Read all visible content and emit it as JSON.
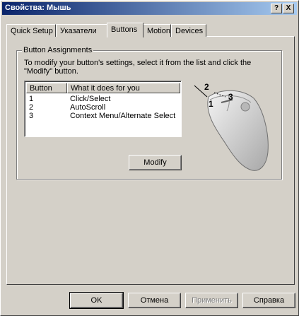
{
  "window": {
    "title": "Свойства: Мышь"
  },
  "title_buttons": {
    "help": "?",
    "close": "X"
  },
  "tabs": [
    {
      "label": "Quick Setup"
    },
    {
      "label": "Указатели"
    },
    {
      "label": "Buttons"
    },
    {
      "label": "Motion"
    },
    {
      "label": "Devices"
    }
  ],
  "active_tab": "Buttons",
  "group": {
    "label": "Button Assignments",
    "instructions": "To modify your button's settings, select it from the list and click the \"Modify\" button."
  },
  "list": {
    "columns": [
      "Button",
      "What it does for you"
    ],
    "rows": [
      {
        "button": "1",
        "action": "Click/Select"
      },
      {
        "button": "2",
        "action": "AutoScroll"
      },
      {
        "button": "3",
        "action": "Context Menu/Alternate Select"
      }
    ]
  },
  "mouse_labels": {
    "b1": "1",
    "b2": "2",
    "b3": "3"
  },
  "modify_button": "Modify",
  "footer": {
    "ok": "OK",
    "cancel": "Отмена",
    "apply": "Применить",
    "help": "Справка"
  },
  "colors": {
    "title_start": "#0a246a",
    "title_end": "#a6caf0",
    "face": "#d4d0c8"
  }
}
